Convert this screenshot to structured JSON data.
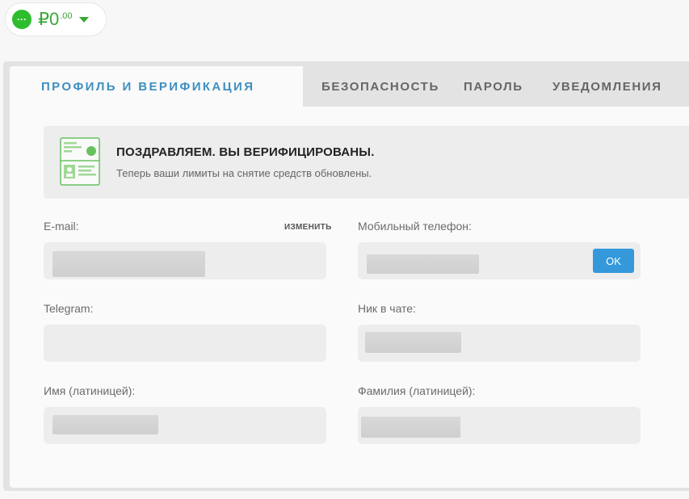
{
  "wallet": {
    "currency_symbol": "₽",
    "amount_main": "0",
    "amount_cents": ".00",
    "menu_glyph": "···"
  },
  "tabs": [
    {
      "label": "Профиль и верификация"
    },
    {
      "label": "Безопасность"
    },
    {
      "label": "Пароль"
    },
    {
      "label": "Уведомления"
    }
  ],
  "banner": {
    "title": "ПОЗДРАВЛЯЕМ. ВЫ ВЕРИФИЦИРОВАНЫ.",
    "subtitle": "Теперь ваши лимиты на снятие средств обновлены."
  },
  "fields": {
    "email": {
      "label": "E-mail:",
      "change_label": "ИЗМЕНИТЬ",
      "value": ""
    },
    "phone": {
      "label": "Мобильный телефон:",
      "value": "",
      "ok_label": "OK"
    },
    "telegram": {
      "label": "Telegram:",
      "value": ""
    },
    "nick": {
      "label": "Ник в чате:",
      "value": ""
    },
    "first_name": {
      "label": "Имя (латиницей):",
      "value": ""
    },
    "last_name": {
      "label": "Фамилия (латиницей):",
      "value": ""
    }
  },
  "colors": {
    "accent_blue": "#3e8fc1",
    "wallet_green": "#3aa735",
    "ok_button": "#3498db",
    "verified_green": "#67c15e"
  }
}
